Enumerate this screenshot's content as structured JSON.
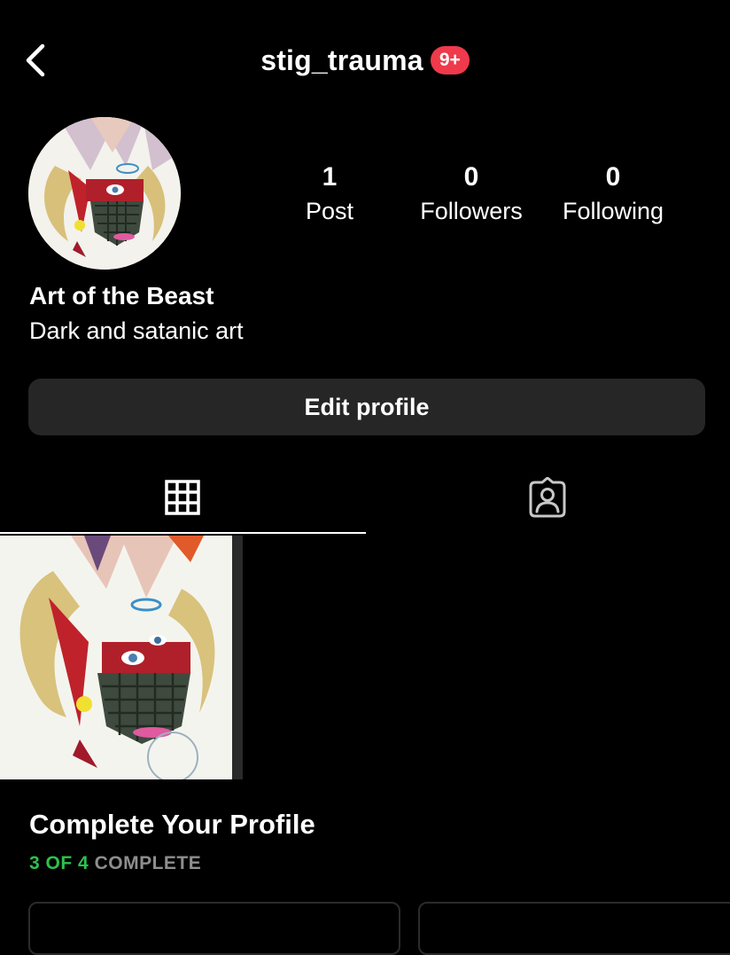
{
  "header": {
    "back_icon": "chevron-left-icon",
    "username": "stig_trauma",
    "notification_badge": "9+",
    "badge_color": "#ef3a4b"
  },
  "profile": {
    "avatar_description_icon": "horned-beast-artwork",
    "display_name": "Art of the Beast",
    "bio": "Dark and satanic art"
  },
  "stats": [
    {
      "count": "1",
      "label": "Post"
    },
    {
      "count": "0",
      "label": "Followers"
    },
    {
      "count": "0",
      "label": "Following"
    }
  ],
  "actions": {
    "edit_profile_label": "Edit profile",
    "button_color": "#262626"
  },
  "tabs": [
    {
      "icon": "grid-icon",
      "active": true
    },
    {
      "icon": "tagged-person-icon",
      "active": false
    }
  ],
  "posts": [
    {
      "image_icon": "horned-beast-artwork"
    }
  ],
  "complete_profile": {
    "title": "Complete Your Profile",
    "progress_done": "3",
    "progress_of": "OF",
    "progress_total": "4",
    "progress_word": "COMPLETE",
    "progress_fraction": 0.75,
    "accent_color": "#2ec04f"
  }
}
